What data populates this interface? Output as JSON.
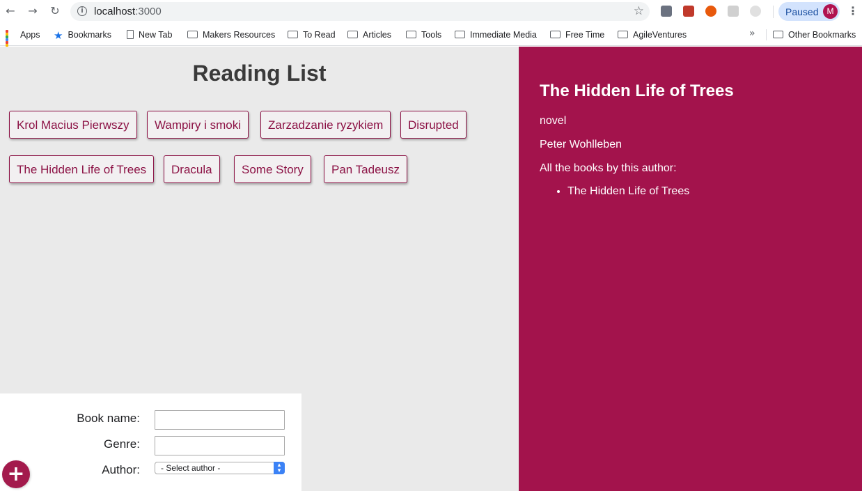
{
  "browser": {
    "url_host": "localhost",
    "url_port": ":3000",
    "profile_status": "Paused",
    "profile_initial": "M",
    "bookmarks": [
      "Apps",
      "Bookmarks",
      "New Tab",
      "Makers Resources",
      "To Read",
      "Articles",
      "Tools",
      "Immediate Media",
      "Free Time",
      "AgileVentures"
    ],
    "overflow": "»",
    "other_bookmarks": "Other Bookmarks"
  },
  "app": {
    "title": "Reading List",
    "books": [
      "Krol Macius Pierwszy",
      "Wampiry i smoki",
      "Zarzadzanie ryzykiem",
      "Disrupted",
      "The Hidden Life of Trees",
      "Dracula",
      "Some Story",
      "Pan Tadeusz"
    ],
    "form": {
      "book_name_label": "Book name:",
      "genre_label": "Genre:",
      "author_label": "Author:",
      "author_placeholder": "- Select author -"
    },
    "add_button": "+",
    "detail": {
      "title": "The Hidden Life of Trees",
      "genre": "novel",
      "author": "Peter Wohlleben",
      "books_by_author_label": "All the books by this author:",
      "books_by_author": [
        "The Hidden Life of Trees"
      ]
    }
  },
  "colors": {
    "accent": "#a3134c",
    "button_text": "#8c1245",
    "left_bg": "#eaeaea"
  }
}
